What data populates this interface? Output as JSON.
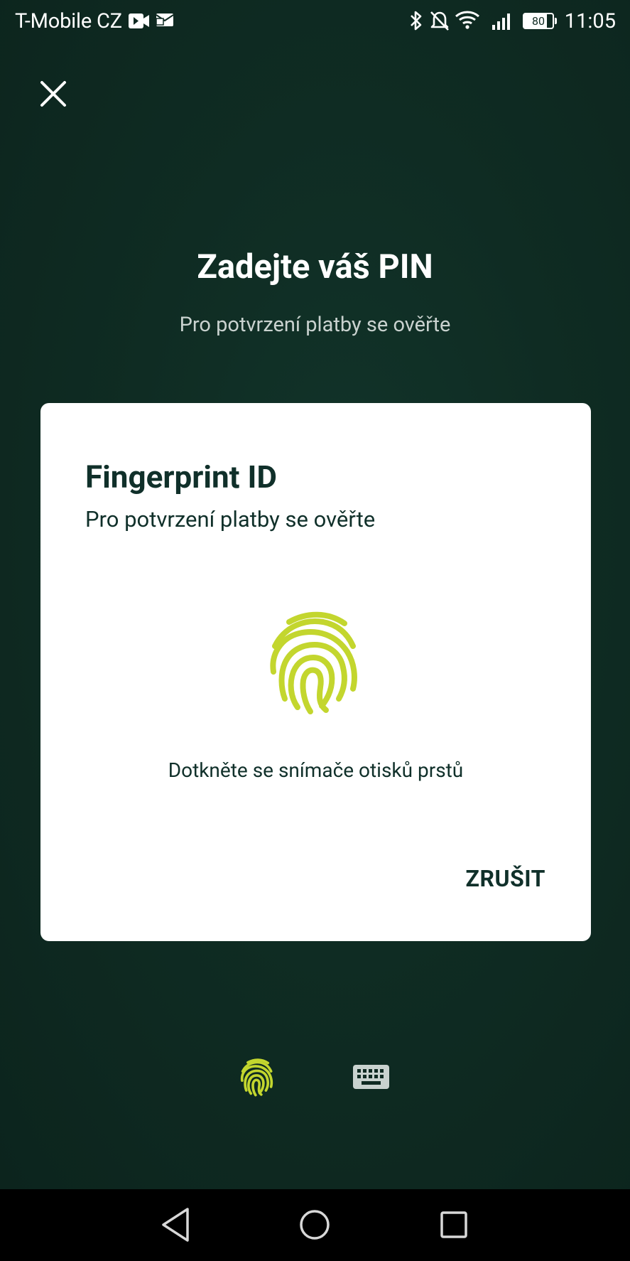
{
  "status_bar": {
    "carrier": "T-Mobile CZ",
    "battery": "80",
    "time": "11:05",
    "icons": [
      "video-icon",
      "message-icon",
      "bluetooth-icon",
      "mute-icon",
      "wifi-icon",
      "signal-icon",
      "battery-icon"
    ]
  },
  "header": {
    "title": "Zadejte váš PIN",
    "subtitle": "Pro potvrzení platby se ověřte"
  },
  "dialog": {
    "title": "Fingerprint ID",
    "subtitle": "Pro potvrzení platby se ověřte",
    "hint": "Dotkněte se snímače otisků prstů",
    "cancel_label": "ZRUŠIT"
  },
  "auth_toggle": {
    "options": [
      "fingerprint-icon",
      "keyboard-icon"
    ],
    "active": "fingerprint"
  },
  "colors": {
    "background": "#0f2a22",
    "accent": "#c3d62e",
    "dialog_text": "#10302a"
  }
}
